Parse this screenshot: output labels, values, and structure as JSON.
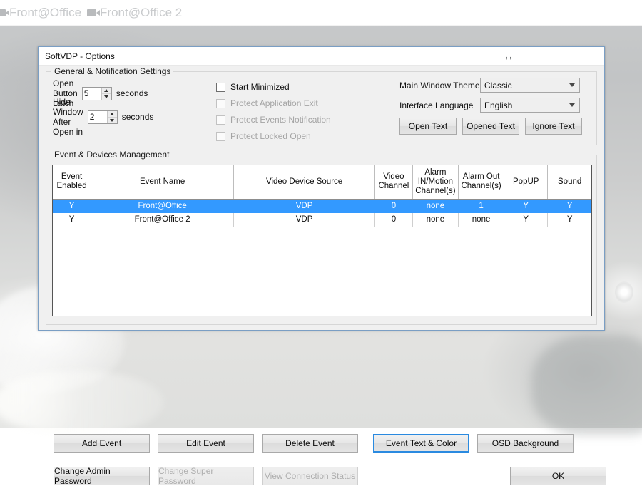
{
  "topbar": {
    "tabs": [
      {
        "icon": "video-camera-icon",
        "label": "Front@Office"
      },
      {
        "icon": "video-camera-icon",
        "label": "Front@Office 2"
      }
    ]
  },
  "dialog": {
    "title": "SoftVDP - Options",
    "resize_icon": "horizontal-resize-cursor-icon",
    "resize_glyph": "↔"
  },
  "general_group": {
    "legend": "General & Notification Settings",
    "open_button_latch": {
      "label": "Open Button Latch",
      "value": "5",
      "unit": "seconds"
    },
    "hide_window_after_open": {
      "label": "Hide Window After Open in",
      "value": "2",
      "unit": "seconds"
    },
    "checkboxes": [
      {
        "label": "Start Minimized",
        "checked": false,
        "enabled": true
      },
      {
        "label": "Protect Application Exit",
        "checked": false,
        "enabled": false
      },
      {
        "label": "Protect Events Notification",
        "checked": false,
        "enabled": false
      },
      {
        "label": "Protect Locked Open",
        "checked": false,
        "enabled": false
      }
    ],
    "main_window_theme": {
      "label": "Main Window Theme",
      "value": "Classic"
    },
    "interface_language": {
      "label": "Interface Language",
      "value": "English"
    },
    "text_buttons": [
      {
        "label": "Open Text"
      },
      {
        "label": "Opened Text"
      },
      {
        "label": "Ignore Text"
      }
    ]
  },
  "events_group": {
    "legend": "Event & Devices Management",
    "table": {
      "columns": [
        "Event\nEnabled",
        "Event Name",
        "Video Device Source",
        "Video\nChannel",
        "Alarm\nIN/Motion\nChannel(s)",
        "Alarm Out\nChannel(s)",
        "PopUP",
        "Sound"
      ],
      "rows": [
        {
          "selected": true,
          "cells": [
            "Y",
            "Front@Office",
            "VDP",
            "0",
            "none",
            "1",
            "Y",
            "Y"
          ]
        },
        {
          "selected": false,
          "cells": [
            "Y",
            "Front@Office 2",
            "VDP",
            "0",
            "none",
            "none",
            "Y",
            "Y"
          ]
        }
      ]
    }
  },
  "actions": {
    "row1": [
      {
        "label": "Add Event",
        "enabled": true,
        "focused": false
      },
      {
        "label": "Edit Event",
        "enabled": true,
        "focused": false
      },
      {
        "label": "Delete Event",
        "enabled": true,
        "focused": false
      },
      {
        "label": "Event Text & Color",
        "enabled": true,
        "focused": true
      },
      {
        "label": "OSD Background",
        "enabled": true,
        "focused": false
      }
    ],
    "row2": [
      {
        "label": "Change Admin Password",
        "enabled": true
      },
      {
        "label": "Change Super Password",
        "enabled": false
      },
      {
        "label": "View Connection Status",
        "enabled": false
      }
    ],
    "ok": {
      "label": "OK"
    }
  },
  "colors": {
    "selection_blue": "#3399ff",
    "focus_blue": "#2a8ae0",
    "dialog_border": "#7a9ec4",
    "dialog_face": "#f0f0f0",
    "disabled_text": "#aeaeae"
  }
}
